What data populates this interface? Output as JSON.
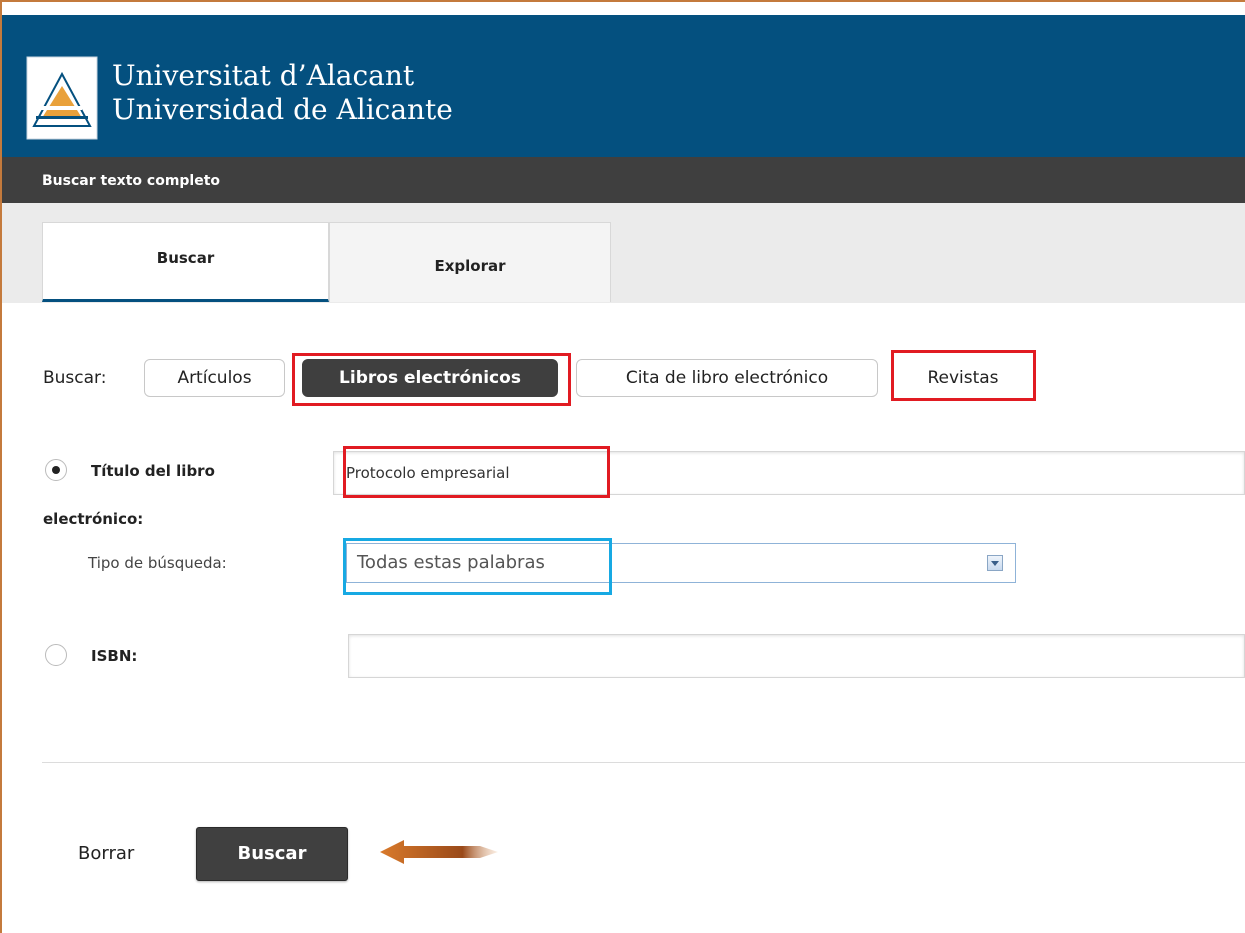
{
  "header": {
    "university_line1": "Universitat d’Alacant",
    "university_line2": "Universidad de Alicante"
  },
  "titlebar": {
    "title": "Buscar texto completo"
  },
  "tabs": [
    {
      "label": "Buscar",
      "active": true
    },
    {
      "label": "Explorar",
      "active": false
    }
  ],
  "search_type": {
    "label": "Buscar:",
    "options": [
      {
        "label": "Artículos",
        "selected": false
      },
      {
        "label": "Libros electrónicos",
        "selected": true
      },
      {
        "label": "Cita de libro electrónico",
        "selected": false
      },
      {
        "label": "Revistas",
        "selected": false
      }
    ]
  },
  "form": {
    "title_option": {
      "label_line1": "Título del libro",
      "label_line2": "electrónico:",
      "checked": true,
      "value": "Protocolo empresarial"
    },
    "search_kind": {
      "label": "Tipo de búsqueda:",
      "selected": "Todas estas palabras"
    },
    "isbn_option": {
      "label": "ISBN:",
      "checked": false,
      "value": ""
    }
  },
  "actions": {
    "clear_label": "Borrar",
    "search_label": "Buscar"
  },
  "colors": {
    "header_bg": "#04507f",
    "titlebar_bg": "#3f3f3f",
    "highlight_red": "#e11b22",
    "highlight_blue": "#17a9e3",
    "arrow_orange": "#d97a2b"
  }
}
